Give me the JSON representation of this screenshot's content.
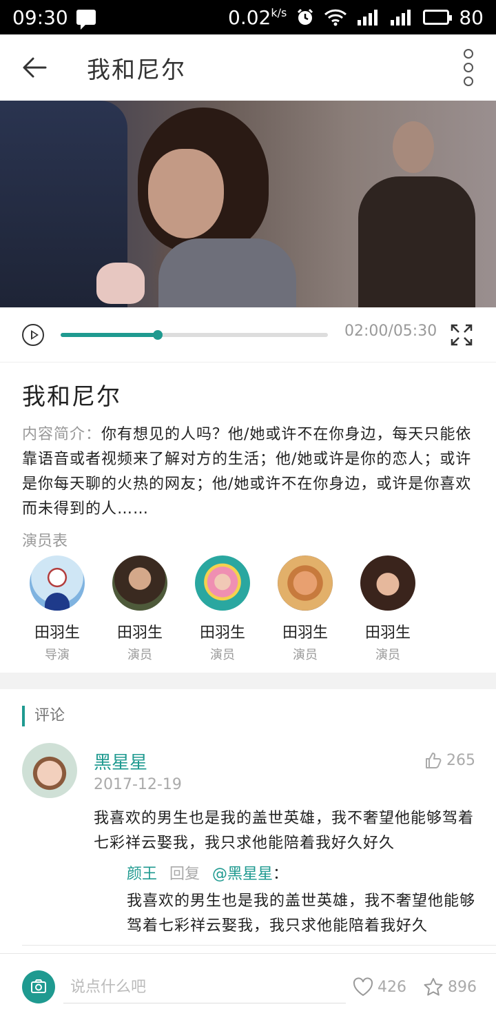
{
  "status_bar": {
    "time": "09:30",
    "net_speed": "0.02",
    "net_unit": "k/s",
    "battery": "80"
  },
  "header": {
    "title": "我和尼尔"
  },
  "player": {
    "time": "02:00/05:30",
    "progress": 0.363
  },
  "movie": {
    "title": "我和尼尔",
    "synopsis_label": "内容简介：",
    "synopsis": "你有想见的人吗？他/她或许不在你身边，每天只能依靠语音或者视频来了解对方的生活；他/她或许是你的恋人；或许是你每天聊的火热的网友；他/她或许不在你身边，或许是你喜欢而未得到的人……",
    "cast_label": "演员表",
    "cast": [
      {
        "name": "田羽生",
        "role": "导演"
      },
      {
        "name": "田羽生",
        "role": "演员"
      },
      {
        "name": "田羽生",
        "role": "演员"
      },
      {
        "name": "田羽生",
        "role": "演员"
      },
      {
        "name": "田羽生",
        "role": "演员"
      }
    ]
  },
  "comments": {
    "section_title": "评论",
    "items": [
      {
        "user": "黑星星",
        "date": "2017-12-19",
        "likes": "265",
        "text": "我喜欢的男生也是我的盖世英雄，我不奢望他能够驾着七彩祥云娶我，我只求他能陪着我好久好久",
        "reply": {
          "user": "颜王",
          "action": "回复",
          "target": "@黑星星",
          "colon": "：",
          "text": "我喜欢的男生也是我的盖世英雄，我不奢望他能够驾着七彩祥云娶我，我只求他能陪着我好久"
        }
      }
    ]
  },
  "bottom": {
    "placeholder": "说点什么吧",
    "likes": "426",
    "favorites": "896"
  },
  "colors": {
    "accent": "#1f9a90"
  }
}
